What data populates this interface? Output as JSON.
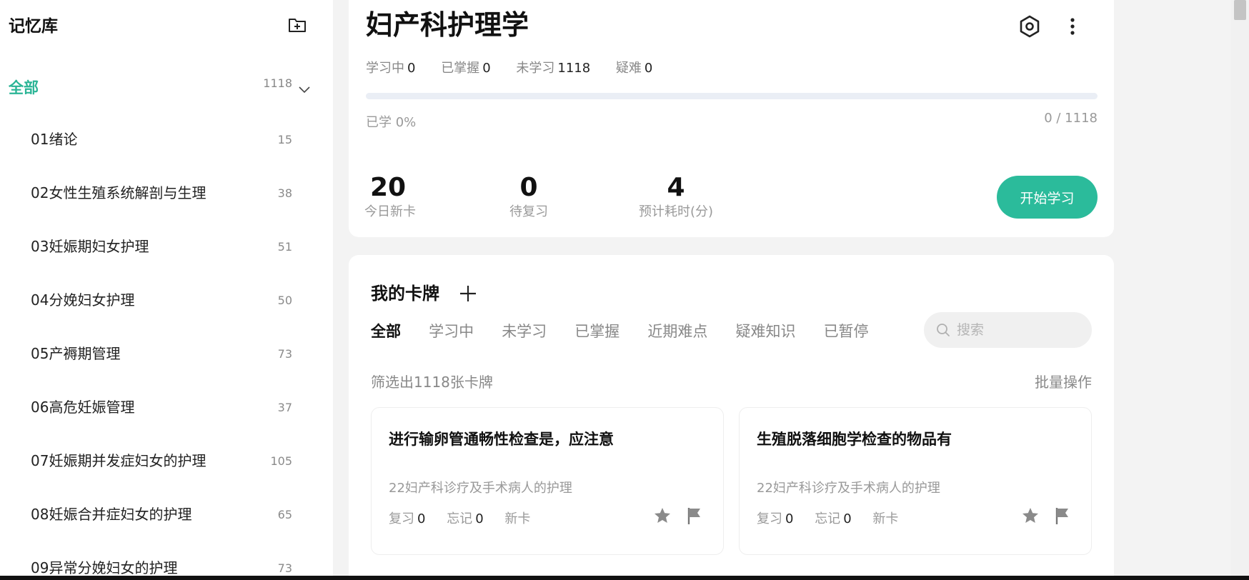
{
  "sidebar": {
    "title": "记忆库",
    "all": {
      "label": "全部",
      "count": "1118"
    },
    "items": [
      {
        "label": "01绪论",
        "count": "15"
      },
      {
        "label": "02女性生殖系统解剖与生理",
        "count": "38"
      },
      {
        "label": "03妊娠期妇女护理",
        "count": "51"
      },
      {
        "label": "04分娩妇女护理",
        "count": "50"
      },
      {
        "label": "05产褥期管理",
        "count": "73"
      },
      {
        "label": "06高危妊娠管理",
        "count": "37"
      },
      {
        "label": "07妊娠期并发症妇女的护理",
        "count": "105"
      },
      {
        "label": "08妊娠合并症妇女的护理",
        "count": "65"
      },
      {
        "label": "09异常分娩妇女的护理",
        "count": "73"
      }
    ]
  },
  "deck": {
    "title": "妇产科护理学",
    "stats": [
      {
        "label": "学习中",
        "value": "0"
      },
      {
        "label": "已掌握",
        "value": "0"
      },
      {
        "label": "未学习",
        "value": "1118"
      },
      {
        "label": "疑难",
        "value": "0"
      }
    ],
    "progress_fraction": 0,
    "learned_label": "已学 0%",
    "ratio": "0 / 1118",
    "today_new": {
      "value": "20",
      "label": "今日新卡"
    },
    "pending_review": {
      "value": "0",
      "label": "待复习"
    },
    "estimated_time": {
      "value": "4",
      "label": "预计耗时(分)"
    },
    "start_button": "开始学习"
  },
  "cards": {
    "title": "我的卡牌",
    "tabs": [
      "全部",
      "学习中",
      "未学习",
      "已掌握",
      "近期难点",
      "疑难知识",
      "已暂停"
    ],
    "active_tab": "全部",
    "search_placeholder": "搜索",
    "filter_info": "筛选出1118张卡牌",
    "bulk_action": "批量操作",
    "items": [
      {
        "question": "进行输卵管通畅性检查是，应注意",
        "category": "22妇产科诊疗及手术病人的护理",
        "review_label": "复习",
        "review": "0",
        "forget_label": "忘记",
        "forget": "0",
        "status": "新卡"
      },
      {
        "question": "生殖脱落细胞学检查的物品有",
        "category": "22妇产科诊疗及手术病人的护理",
        "review_label": "复习",
        "review": "0",
        "forget_label": "忘记",
        "forget": "0",
        "status": "新卡"
      }
    ]
  },
  "icons": {
    "add_folder": "folder-plus-icon",
    "chevron": "chevron-down-icon",
    "target": "target-icon",
    "more": "more-vertical-icon",
    "plus": "plus-icon",
    "search": "search-icon",
    "star": "star-icon",
    "flag": "flag-icon"
  },
  "colors": {
    "accent": "#2bb596",
    "button": "#2bbb9b",
    "background": "#f3f3f3"
  }
}
